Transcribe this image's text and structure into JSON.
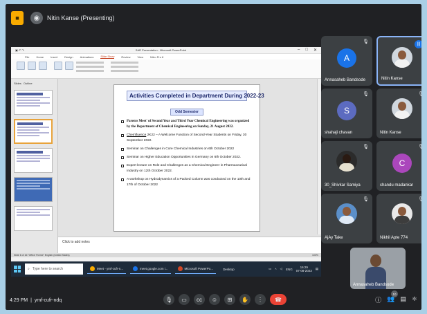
{
  "meet": {
    "presenter_label": "Nitin Kanse (Presenting)",
    "meeting_time": "4:29 PM",
    "separator": "|",
    "meeting_code": "ymf-cufr-ndq",
    "participants_badge": "10"
  },
  "ppt": {
    "window_title": "SAR Presentation - Microsoft PowerPoint",
    "tabs": [
      "File",
      "Home",
      "Insert",
      "Design",
      "Animations",
      "Slide Show",
      "Review",
      "View",
      "Nitro Pro 8"
    ],
    "thumb_tabs": [
      "Slides",
      "Outline"
    ],
    "notes_placeholder": "Click to add notes",
    "status_left": "Slide 6 of 16   \"Office Theme\"   English (United States)",
    "status_right": "100%"
  },
  "slide": {
    "title": "Activities Completed in Department During 2022-23",
    "subtitle": "Odd Semester",
    "bullets": [
      {
        "lead": "",
        "text": "Parents Meet' of Second Year and Third Year Chemical Engineering was organized by the Department of Chemical Engineering on Sunday, 21 August 2022.",
        "bold": true
      },
      {
        "lead": "Chemfluence",
        "text": " 2K22 – A Welcome Function of Second-Year Students on Friday, 30 September 2022.",
        "bold": false
      },
      {
        "lead": "",
        "text": "Seminar on Challenges in Core Chemical Industries on 6th October 2022",
        "bold": false
      },
      {
        "lead": "",
        "text": "Seminar on Higher Education Opportunities in Germany on 6th October 2022.",
        "bold": false
      },
      {
        "lead": "",
        "text": "Expert lecture on Role and Challenges as a Chemical Engineer in Pharmaceutical Industry on 12th October 2022.",
        "bold": false
      },
      {
        "lead": "",
        "text": "A workshop on Hydrodynamics of a Packed Column was conducted on the 10th and 17th of October 2022",
        "bold": false
      }
    ]
  },
  "taskbar": {
    "search_placeholder": "Type here to search",
    "apps": [
      "Meet - ymf-cufr-n...",
      "meet.google.com i...",
      "Microsoft PowerPo...",
      "Desktop"
    ],
    "clock_time": "16:29",
    "clock_date": "07-08-2023",
    "lang": "ENG"
  },
  "participants": [
    {
      "name": "Annasaheb Bandsode",
      "initial": "A",
      "color": "#1a73e8"
    },
    {
      "name": "Nitin Kanse",
      "initial": "",
      "color": ""
    },
    {
      "name": "shahaji chavan",
      "initial": "S",
      "color": "#5c6bc0"
    },
    {
      "name": "Nitin Kanse",
      "initial": "",
      "color": ""
    },
    {
      "name": "30_Shivkar Samiya",
      "initial": "",
      "color": ""
    },
    {
      "name": "chandu madankar",
      "initial": "C",
      "color": "#ab47bc"
    },
    {
      "name": "AjAy Take",
      "initial": "",
      "color": ""
    },
    {
      "name": "Nikhil Apte 774",
      "initial": "",
      "color": ""
    }
  ],
  "self_view": {
    "name": "Annasaheb Bandsode"
  },
  "icons": {
    "mic_off": "mic-off-icon",
    "camera": "camera-icon",
    "captions": "captions-icon",
    "emoji": "emoji-icon",
    "present": "present-icon",
    "hand": "raise-hand-icon",
    "more": "more-icon",
    "end_call": "end-call-icon"
  }
}
